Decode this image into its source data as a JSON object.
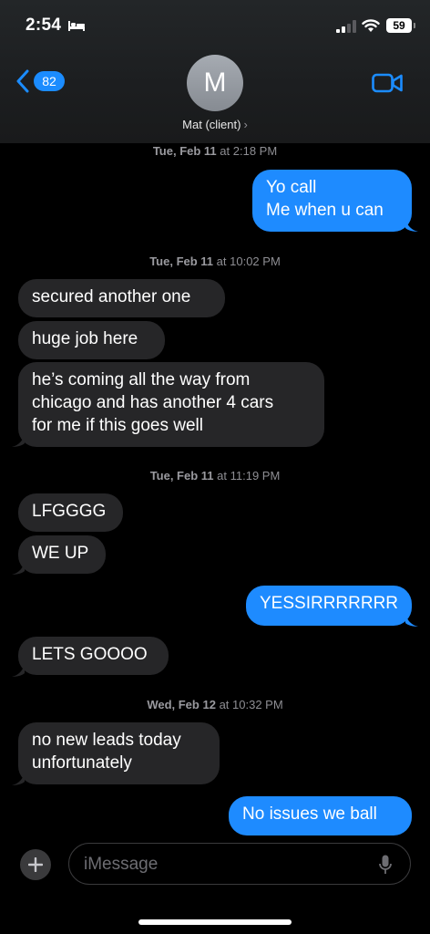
{
  "status_bar": {
    "time": "2:54",
    "battery": "59"
  },
  "header": {
    "back_count": "82",
    "avatar_initial": "M",
    "contact_name": "Mat (client)",
    "chevron": "›"
  },
  "timestamps": [
    {
      "day": "Tue, Feb 11",
      "time": "at 2:18 PM"
    },
    {
      "day": "Tue, Feb 11",
      "time": "at 10:02 PM"
    },
    {
      "day": "Tue, Feb 11",
      "time": "at 11:19 PM"
    },
    {
      "day": "Wed, Feb 12",
      "time": "at 10:32 PM"
    }
  ],
  "messages": [
    {
      "direction": "out",
      "text": "Yo call\nMe when u can"
    },
    {
      "direction": "in",
      "text": "secured another one"
    },
    {
      "direction": "in",
      "text": "huge job here"
    },
    {
      "direction": "in",
      "text": "he’s coming all the way from\nchicago and has another 4 cars\nfor me if this goes well"
    },
    {
      "direction": "in",
      "text": "LFGGGG"
    },
    {
      "direction": "in",
      "text": "WE UP"
    },
    {
      "direction": "out",
      "text": "YESSIRRRRRRR"
    },
    {
      "direction": "in",
      "text": "LETS GOOOO"
    },
    {
      "direction": "in",
      "text": "no new leads today\nunfortunately"
    },
    {
      "direction": "out",
      "text": "No issues we ball"
    }
  ],
  "input": {
    "placeholder": "iMessage"
  },
  "icons": [
    "bed-icon",
    "signal-icon",
    "wifi-icon",
    "back-chevron-icon",
    "video-camera-icon",
    "plus-icon",
    "microphone-icon"
  ],
  "colors": {
    "outgoing": "#1e8bff",
    "incoming": "#262628",
    "accent": "#1b8cff"
  }
}
